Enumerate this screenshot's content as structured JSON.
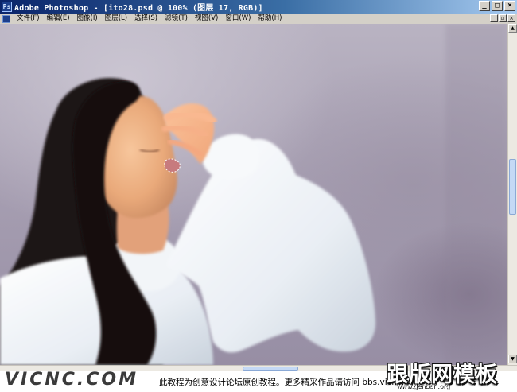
{
  "window": {
    "app_icon": "Ps",
    "title": "Adobe Photoshop - [ito28.psd @ 100% (图层 17, RGB)]",
    "controls": [
      "minimize-icon",
      "maximize-icon",
      "close-icon"
    ]
  },
  "menu": {
    "items": [
      {
        "label": "文件(F)"
      },
      {
        "label": "编辑(E)"
      },
      {
        "label": "图像(I)"
      },
      {
        "label": "图层(L)"
      },
      {
        "label": "选择(S)"
      },
      {
        "label": "滤镜(T)"
      },
      {
        "label": "视图(V)"
      },
      {
        "label": "窗口(W)"
      },
      {
        "label": "帮助(H)"
      }
    ]
  },
  "watermark": {
    "site": "VICNC.COM",
    "caption": "此教程为创意设计论坛原创教程。更多精采作品请访问 bbs.vicnc.com",
    "logo": "跟版网模板",
    "logo_sub": "www.genban.org"
  },
  "colors": {
    "titlebar_start": "#0a246a",
    "titlebar_end": "#a6caf0",
    "chrome": "#d4d0c8"
  }
}
